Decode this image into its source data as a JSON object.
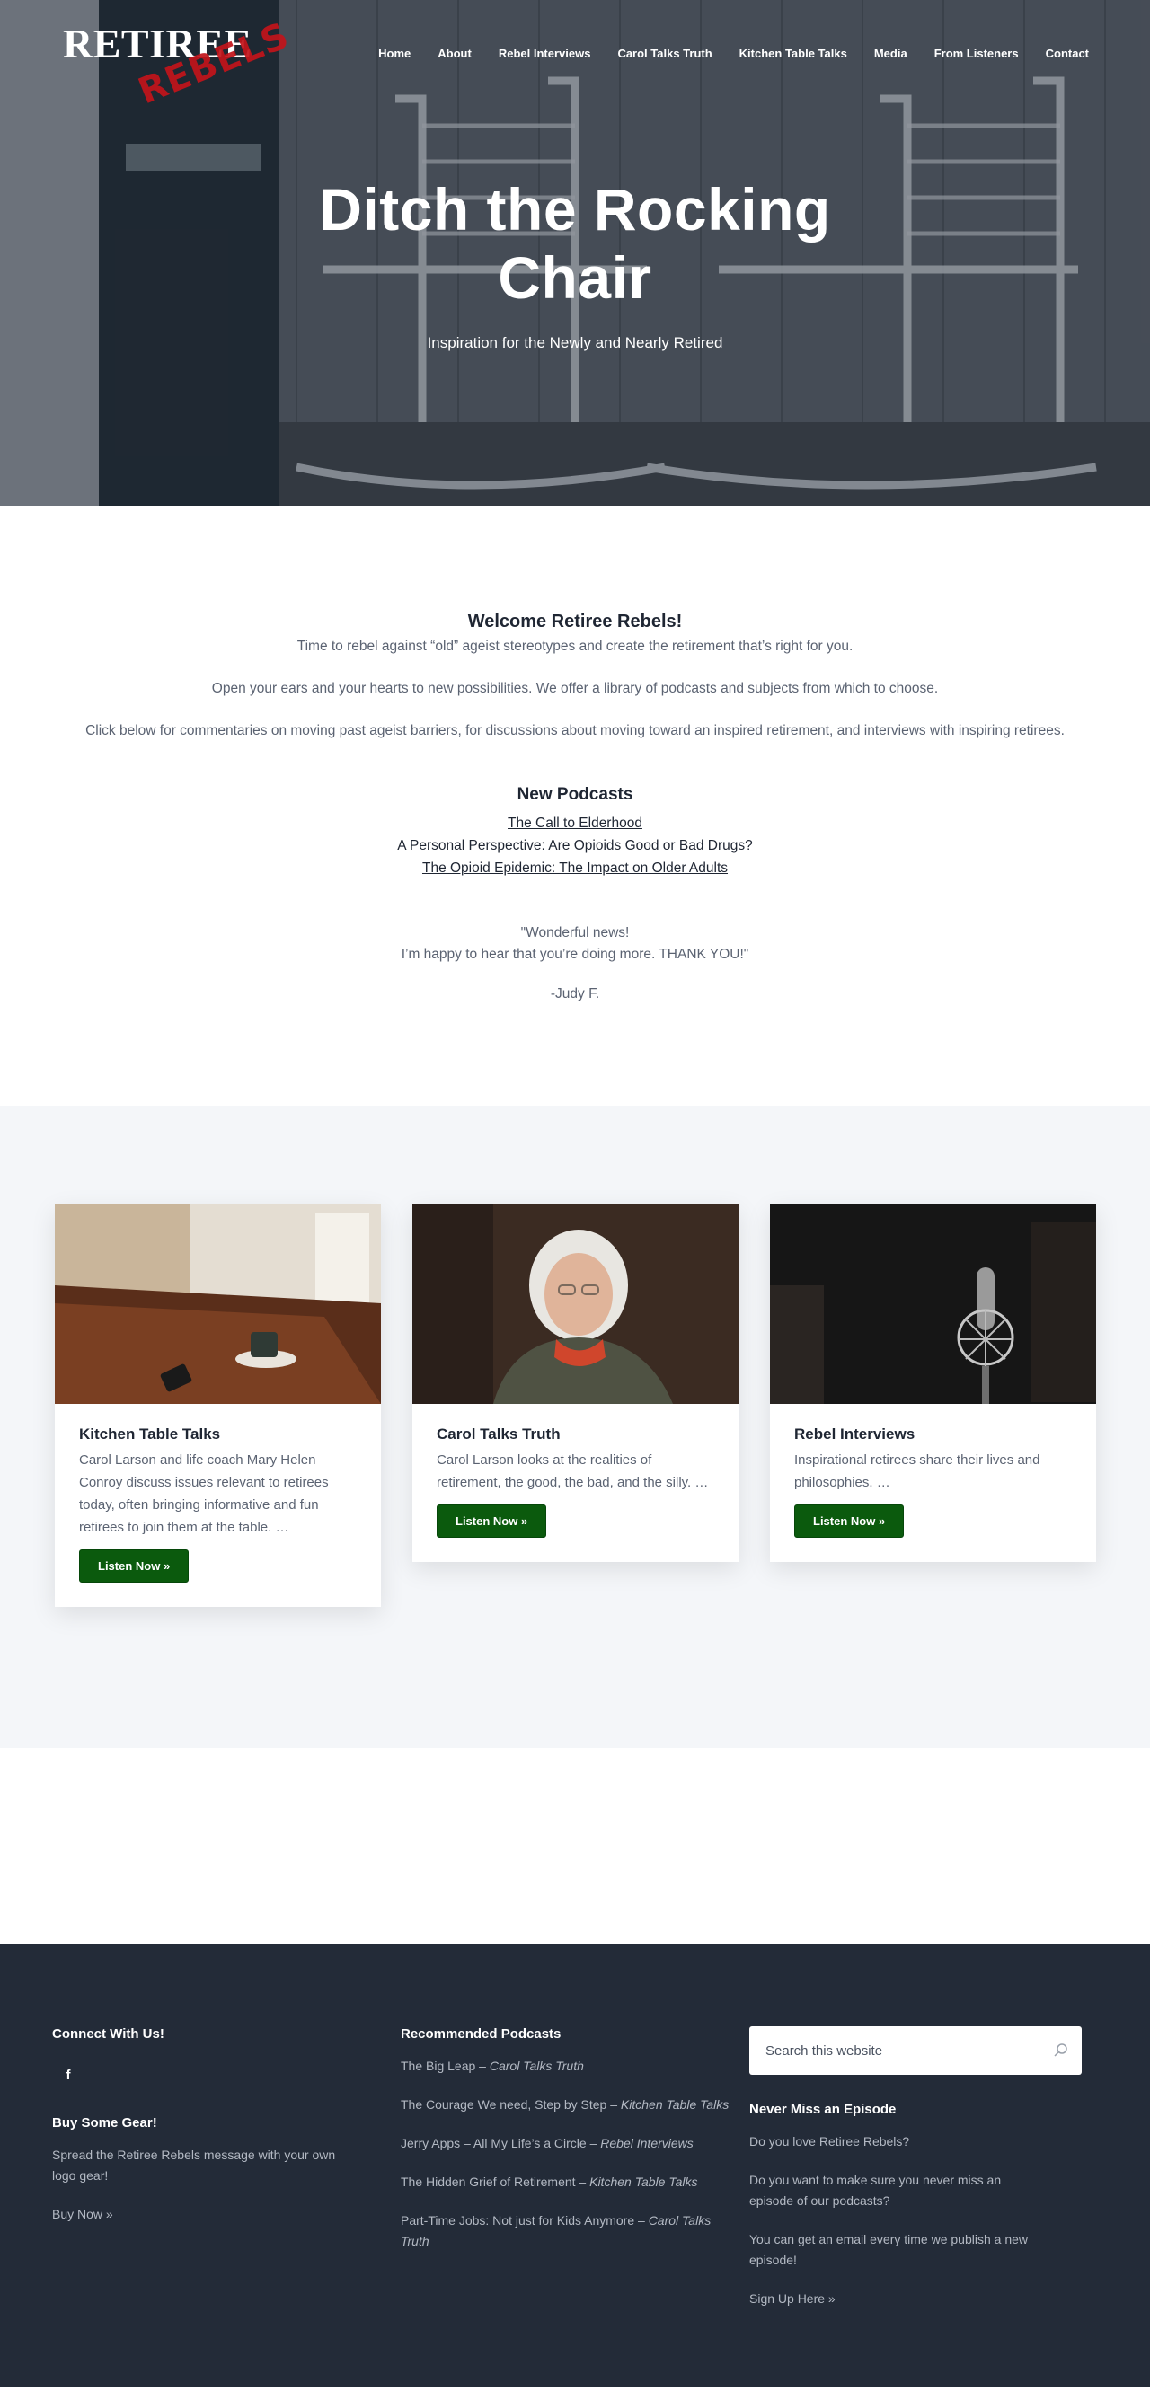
{
  "site": {
    "logo_text": "RETIREE",
    "logo_stamp": "REBELS"
  },
  "nav": {
    "items": [
      "Home",
      "About",
      "Rebel Interviews",
      "Carol Talks Truth",
      "Kitchen Table Talks",
      "Media",
      "From Listeners",
      "Contact"
    ]
  },
  "hero": {
    "title": "Ditch the Rocking Chair",
    "subtitle": "Inspiration for the Newly and Nearly Retired"
  },
  "welcome": {
    "heading": "Welcome Retiree Rebels!",
    "p1": "Time to rebel against “old” ageist stereotypes and create the retirement that’s right for you.",
    "p2": "Open your ears and your hearts to new possibilities. We offer a library of podcasts and subjects from which to choose.",
    "p3": "Click below for commentaries on moving past ageist barriers, for discussions about moving toward an inspired retirement, and interviews with inspiring retirees."
  },
  "new_podcasts": {
    "heading": "New Podcasts",
    "links": [
      "The Call to Elderhood",
      "A Personal Perspective: Are Opioids Good or Bad Drugs?",
      "The Opioid Epidemic: The Impact on Older Adults"
    ]
  },
  "testimonial": {
    "line1": "\"Wonderful news!",
    "line2": "I’m happy to hear that you’re doing more. THANK YOU!\"",
    "author": "-Judy F."
  },
  "cards": [
    {
      "title": "Kitchen Table Talks",
      "desc": "Carol Larson and life coach Mary Helen Conroy discuss issues relevant to retirees today, often bringing informative and fun retirees to join them at the table.   …",
      "button": "Listen Now »"
    },
    {
      "title": "Carol Talks Truth",
      "desc": "Carol Larson looks at the realities of retirement, the good, the bad, and the silly.   …",
      "button": "Listen Now »"
    },
    {
      "title": "Rebel Interviews",
      "desc": " Inspirational retirees share their lives and philosophies.   …",
      "button": "Listen Now »"
    }
  ],
  "footer": {
    "connect_heading": "Connect With Us!",
    "facebook_glyph": "f",
    "gear_heading": "Buy Some Gear!",
    "gear_text": "Spread the Retiree Rebels message with your own logo gear!",
    "gear_link": "Buy Now »",
    "recommended_heading": "Recommended Podcasts",
    "recommended": [
      {
        "title": "The Big Leap – ",
        "show": "Carol Talks Truth"
      },
      {
        "title": "The Courage We need, Step by Step – ",
        "show": "Kitchen Table Talks"
      },
      {
        "title": "Jerry Apps – All My Life’s a Circle – ",
        "show": "Rebel Interviews"
      },
      {
        "title": "The Hidden Grief of Retirement – ",
        "show": "Kitchen Table Talks"
      },
      {
        "title": "Part-Time Jobs: Not just for Kids Anymore – ",
        "show": "Carol Talks Truth"
      }
    ],
    "search_placeholder": "Search this website",
    "episode_heading": "Never Miss an Episode",
    "episode_p1": "Do you love Retiree Rebels?",
    "episode_p2": "Do you want to make sure you never miss an episode of our podcasts?",
    "episode_p3": "You can get an email every time we publish a new episode!",
    "signup_link": "Sign Up Here »"
  }
}
